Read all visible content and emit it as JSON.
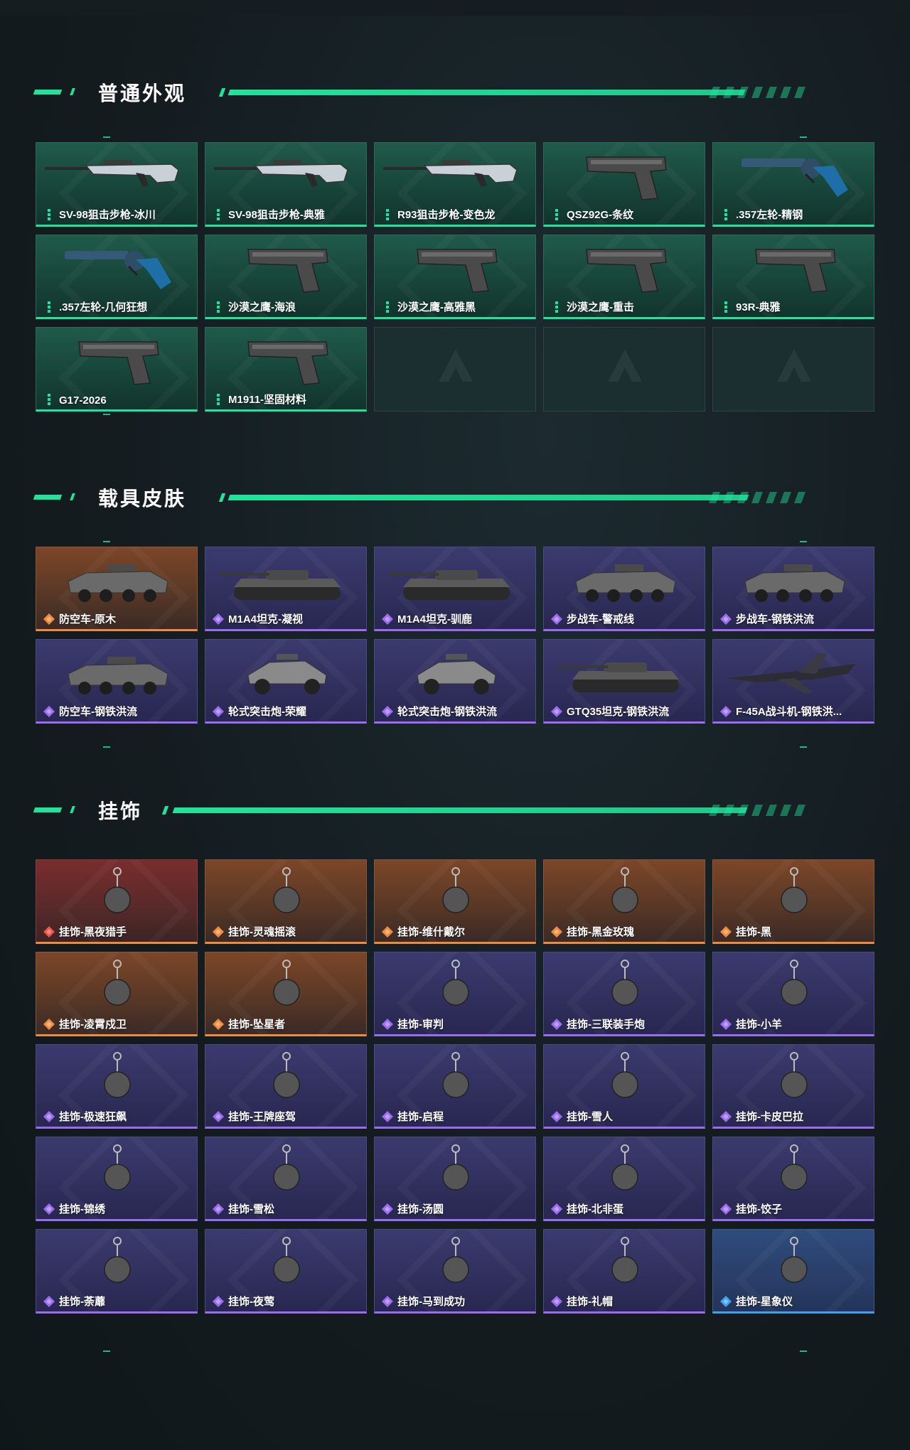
{
  "sections": [
    {
      "title": "普通外观"
    },
    {
      "title": "载具皮肤"
    },
    {
      "title": "挂饰"
    }
  ],
  "colors": {
    "accent": "#22e39a",
    "green_rarity": "#22e39a",
    "purple_rarity": "#9a6cf0",
    "orange_rarity": "#f08a3c",
    "blue_rarity": "#3ea2f0"
  },
  "weapons": [
    {
      "label": "SV-98狙击步枪-冰川",
      "rarity": "green",
      "icon": "sniper-rifle-icon"
    },
    {
      "label": "SV-98狙击步枪-典雅",
      "rarity": "green",
      "icon": "sniper-rifle-icon"
    },
    {
      "label": "R93狙击步枪-变色龙",
      "rarity": "green",
      "icon": "sniper-rifle-icon"
    },
    {
      "label": "QSZ92G-条纹",
      "rarity": "green",
      "icon": "pistol-icon"
    },
    {
      "label": ".357左轮-精钢",
      "rarity": "green",
      "icon": "revolver-icon"
    },
    {
      "label": ".357左轮-几何狂想",
      "rarity": "green",
      "icon": "revolver-icon"
    },
    {
      "label": "沙漠之鹰-海浪",
      "rarity": "green",
      "icon": "pistol-icon"
    },
    {
      "label": "沙漠之鹰-高雅黑",
      "rarity": "green",
      "icon": "pistol-icon"
    },
    {
      "label": "沙漠之鹰-重击",
      "rarity": "green",
      "icon": "pistol-icon"
    },
    {
      "label": "93R-典雅",
      "rarity": "green",
      "icon": "pistol-icon"
    },
    {
      "label": "G17-2026",
      "rarity": "green",
      "icon": "pistol-icon"
    },
    {
      "label": "M1911-坚固材料",
      "rarity": "green",
      "icon": "pistol-icon"
    }
  ],
  "vehicles": [
    {
      "label": "防空车-原木",
      "rarity": "orange",
      "icon": "armored-vehicle-icon"
    },
    {
      "label": "M1A4坦克-凝视",
      "rarity": "purple",
      "icon": "tank-icon"
    },
    {
      "label": "M1A4坦克-驯鹿",
      "rarity": "purple",
      "icon": "tank-icon"
    },
    {
      "label": "步战车-警戒线",
      "rarity": "purple",
      "icon": "armored-vehicle-icon"
    },
    {
      "label": "步战车-钢铁洪流",
      "rarity": "purple",
      "icon": "armored-vehicle-icon"
    },
    {
      "label": "防空车-钢铁洪流",
      "rarity": "purple",
      "icon": "armored-vehicle-icon"
    },
    {
      "label": "轮式突击炮-荣耀",
      "rarity": "purple",
      "icon": "buggy-icon"
    },
    {
      "label": "轮式突击炮-钢铁洪流",
      "rarity": "purple",
      "icon": "buggy-icon"
    },
    {
      "label": "GTQ35坦克-钢铁洪流",
      "rarity": "purple",
      "icon": "tank-icon"
    },
    {
      "label": "F-45A战斗机-钢铁洪...",
      "rarity": "purple",
      "icon": "fighter-jet-icon"
    }
  ],
  "charms": [
    {
      "label": "挂饰-黑夜猎手",
      "rarity": "red"
    },
    {
      "label": "挂饰-灵魂摇滚",
      "rarity": "orange"
    },
    {
      "label": "挂饰-维什戴尔",
      "rarity": "orange"
    },
    {
      "label": "挂饰-黑金玫瑰",
      "rarity": "orange"
    },
    {
      "label": "挂饰-黑",
      "rarity": "orange"
    },
    {
      "label": "挂饰-凌霄戍卫",
      "rarity": "orange"
    },
    {
      "label": "挂饰-坠星者",
      "rarity": "orange"
    },
    {
      "label": "挂饰-审判",
      "rarity": "purple"
    },
    {
      "label": "挂饰-三联装手炮",
      "rarity": "purple"
    },
    {
      "label": "挂饰-小羊",
      "rarity": "purple"
    },
    {
      "label": "挂饰-极速狂飙",
      "rarity": "purple"
    },
    {
      "label": "挂饰-王牌座驾",
      "rarity": "purple"
    },
    {
      "label": "挂饰-启程",
      "rarity": "purple"
    },
    {
      "label": "挂饰-雪人",
      "rarity": "purple"
    },
    {
      "label": "挂饰-卡皮巴拉",
      "rarity": "purple"
    },
    {
      "label": "挂饰-锦绣",
      "rarity": "purple"
    },
    {
      "label": "挂饰-雪松",
      "rarity": "purple"
    },
    {
      "label": "挂饰-汤圆",
      "rarity": "purple"
    },
    {
      "label": "挂饰-北非蛋",
      "rarity": "purple"
    },
    {
      "label": "挂饰-饺子",
      "rarity": "purple"
    },
    {
      "label": "挂饰-荼蘼",
      "rarity": "purple"
    },
    {
      "label": "挂饰-夜莺",
      "rarity": "purple"
    },
    {
      "label": "挂饰-马到成功",
      "rarity": "purple"
    },
    {
      "label": "挂饰-礼帽",
      "rarity": "purple"
    },
    {
      "label": "挂饰-星象仪",
      "rarity": "blue"
    }
  ]
}
